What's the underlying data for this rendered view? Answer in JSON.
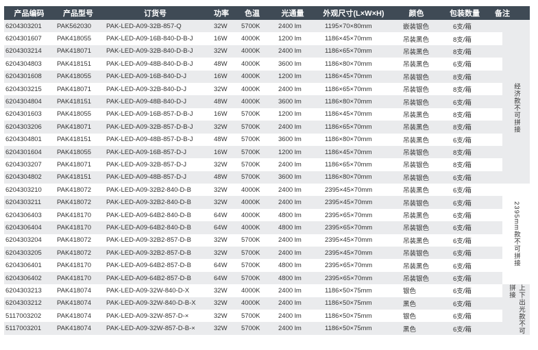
{
  "headers": [
    "产品编码",
    "产品型号",
    "订货号",
    "功率",
    "色温",
    "光通量",
    "外观尺寸(L×W×H)",
    "颜色",
    "包装数量",
    "备注"
  ],
  "rows": [
    [
      "6204303201",
      "PAK562030",
      "PAK-LED-A09-32B-857-Q",
      "32W",
      "5700K",
      "2400 lm",
      "1195×70×80mm",
      "嵌装银色",
      "6支/箱"
    ],
    [
      "6204301607",
      "PAK418055",
      "PAK-LED-A09-16B-840-D-B-J",
      "16W",
      "4000K",
      "1200 lm",
      "1186×45×70mm",
      "吊装黑色",
      "8支/箱"
    ],
    [
      "6204303214",
      "PAK418071",
      "PAK-LED-A09-32B-840-D-B-J",
      "32W",
      "4000K",
      "2400 lm",
      "1186×65×70mm",
      "吊装黑色",
      "8支/箱"
    ],
    [
      "6204304803",
      "PAK418151",
      "PAK-LED-A09-48B-840-D-B-J",
      "48W",
      "4000K",
      "3600 lm",
      "1186×80×70mm",
      "吊装黑色",
      "6支/箱"
    ],
    [
      "6204301608",
      "PAK418055",
      "PAK-LED-A09-16B-840-D-J",
      "16W",
      "4000K",
      "1200 lm",
      "1186×45×70mm",
      "吊装银色",
      "8支/箱"
    ],
    [
      "6204303215",
      "PAK418071",
      "PAK-LED-A09-32B-840-D-J",
      "32W",
      "4000K",
      "2400 lm",
      "1186×65×70mm",
      "吊装银色",
      "8支/箱"
    ],
    [
      "6204304804",
      "PAK418151",
      "PAK-LED-A09-48B-840-D-J",
      "48W",
      "4000K",
      "3600 lm",
      "1186×80×70mm",
      "吊装银色",
      "6支/箱"
    ],
    [
      "6204301603",
      "PAK418055",
      "PAK-LED-A09-16B-857-D-B-J",
      "16W",
      "5700K",
      "1200 lm",
      "1186×45×70mm",
      "吊装黑色",
      "8支/箱"
    ],
    [
      "6204303206",
      "PAK418071",
      "PAK-LED-A09-32B-857-D-B-J",
      "32W",
      "5700K",
      "2400 lm",
      "1186×65×70mm",
      "吊装黑色",
      "8支/箱"
    ],
    [
      "6204304801",
      "PAK418151",
      "PAK-LED-A09-48B-857-D-B-J",
      "48W",
      "5700K",
      "3600 lm",
      "1186×80×70mm",
      "吊装黑色",
      "6支/箱"
    ],
    [
      "6204301604",
      "PAK418055",
      "PAK-LED-A09-16B-857-D-J",
      "16W",
      "5700K",
      "1200 lm",
      "1186×45×70mm",
      "吊装银色",
      "8支/箱"
    ],
    [
      "6204303207",
      "PAK418071",
      "PAK-LED-A09-32B-857-D-J",
      "32W",
      "5700K",
      "2400 lm",
      "1186×65×70mm",
      "吊装银色",
      "8支/箱"
    ],
    [
      "6204304802",
      "PAK418151",
      "PAK-LED-A09-48B-857-D-J",
      "48W",
      "5700K",
      "3600 lm",
      "1186×80×70mm",
      "吊装银色",
      "6支/箱"
    ],
    [
      "6204303210",
      "PAK418072",
      "PAK-LED-A09-32B2-840-D-B",
      "32W",
      "4000K",
      "2400 lm",
      "2395×45×70mm",
      "吊装黑色",
      "6支/箱"
    ],
    [
      "6204303211",
      "PAK418072",
      "PAK-LED-A09-32B2-840-D-B",
      "32W",
      "4000K",
      "2400 lm",
      "2395×45×70mm",
      "吊装银色",
      "6支/箱"
    ],
    [
      "6204306403",
      "PAK418170",
      "PAK-LED-A09-64B2-840-D-B",
      "64W",
      "4000K",
      "4800 lm",
      "2395×65×70mm",
      "吊装黑色",
      "6支/箱"
    ],
    [
      "6204306404",
      "PAK418170",
      "PAK-LED-A09-64B2-840-D-B",
      "64W",
      "4000K",
      "4800 lm",
      "2395×65×70mm",
      "吊装银色",
      "6支/箱"
    ],
    [
      "6204303204",
      "PAK418072",
      "PAK-LED-A09-32B2-857-D-B",
      "32W",
      "5700K",
      "2400 lm",
      "2395×45×70mm",
      "吊装黑色",
      "6支/箱"
    ],
    [
      "6204303205",
      "PAK418072",
      "PAK-LED-A09-32B2-857-D-B",
      "32W",
      "5700K",
      "2400 lm",
      "2395×45×70mm",
      "吊装银色",
      "6支/箱"
    ],
    [
      "6204306401",
      "PAK418170",
      "PAK-LED-A09-64B2-857-D-B",
      "64W",
      "5700K",
      "4800 lm",
      "2395×65×70mm",
      "吊装黑色",
      "6支/箱"
    ],
    [
      "6204306402",
      "PAK418170",
      "PAK-LED-A09-64B2-857-D-B",
      "64W",
      "5700K",
      "4800 lm",
      "2395×65×70mm",
      "吊装银色",
      "6支/箱"
    ],
    [
      "6204303213",
      "PAK418074",
      "PAK-LED-A09-32W-840-D-X",
      "32W",
      "4000K",
      "2400 lm",
      "1186×50×75mm",
      "银色",
      "6支/箱"
    ],
    [
      "6204303212",
      "PAK418074",
      "PAK-LED-A09-32W-840-D-B-X",
      "32W",
      "4000K",
      "2400 lm",
      "1186×50×75mm",
      "黑色",
      "6支/箱"
    ],
    [
      "5117003202",
      "PAK418074",
      "PAK-LED-A09-32W-857-D-×",
      "32W",
      "5700K",
      "2400 lm",
      "1186×50×75mm",
      "银色",
      "6支/箱"
    ],
    [
      "5117003201",
      "PAK418074",
      "PAK-LED-A09-32W-857-D-B-×",
      "32W",
      "5700K",
      "2400 lm",
      "1186×50×75mm",
      "黑色",
      "6支/箱"
    ]
  ],
  "notes": [
    {
      "text": "经济款不可拼接",
      "start": 1,
      "end": 12
    },
    {
      "text": "2395mm款不可拼接",
      "start": 13,
      "end": 20
    },
    {
      "text": "上下出光款不可拼接",
      "start": 21,
      "end": 24
    }
  ]
}
